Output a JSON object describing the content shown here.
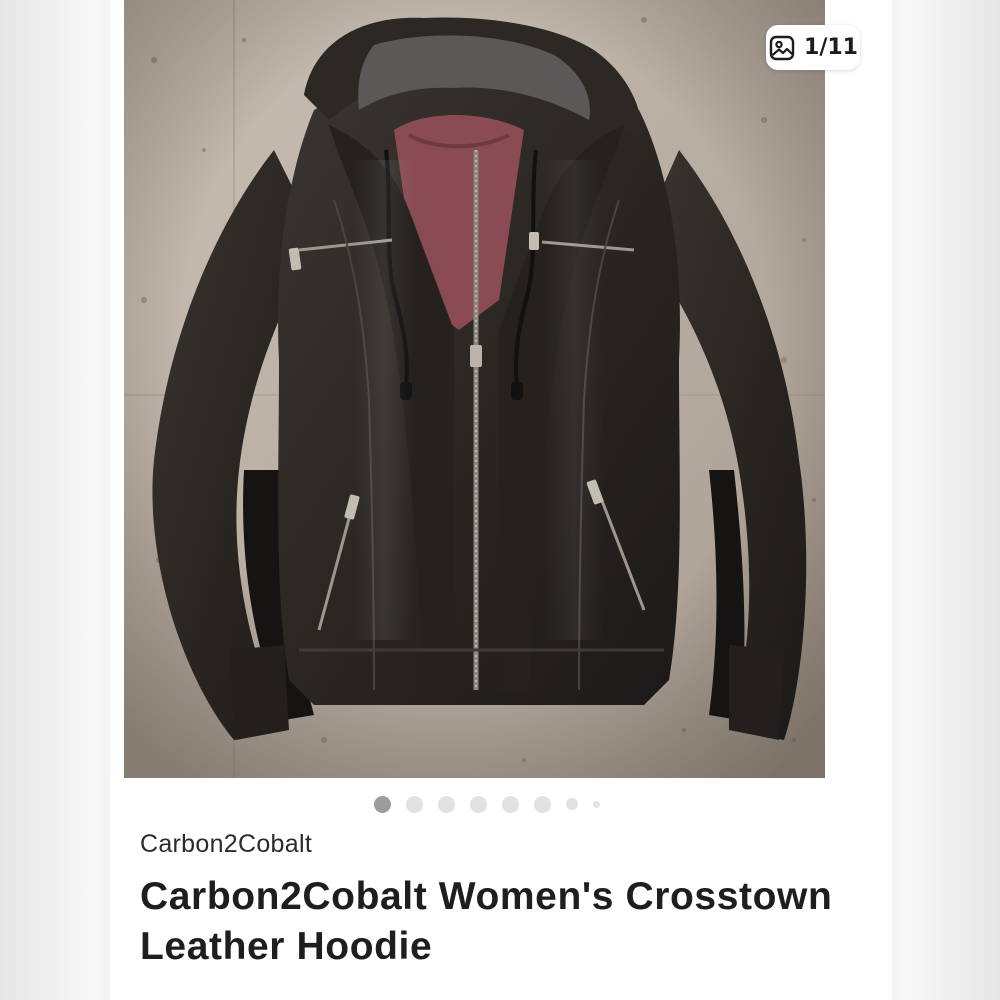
{
  "gallery": {
    "counter_text": "1/11",
    "dots_count": 8,
    "active_index": 0,
    "photo_alt_icon": "image-icon"
  },
  "listing": {
    "brand": "Carbon2Cobalt",
    "title_line1": "Carbon2Cobalt Women's Crosstown",
    "title_line2": "Leather Hoodie"
  },
  "colors": {
    "active_dot": "#9c9c9c",
    "inactive_dot": "#e2e2e2",
    "text": "#1e1e1e"
  }
}
